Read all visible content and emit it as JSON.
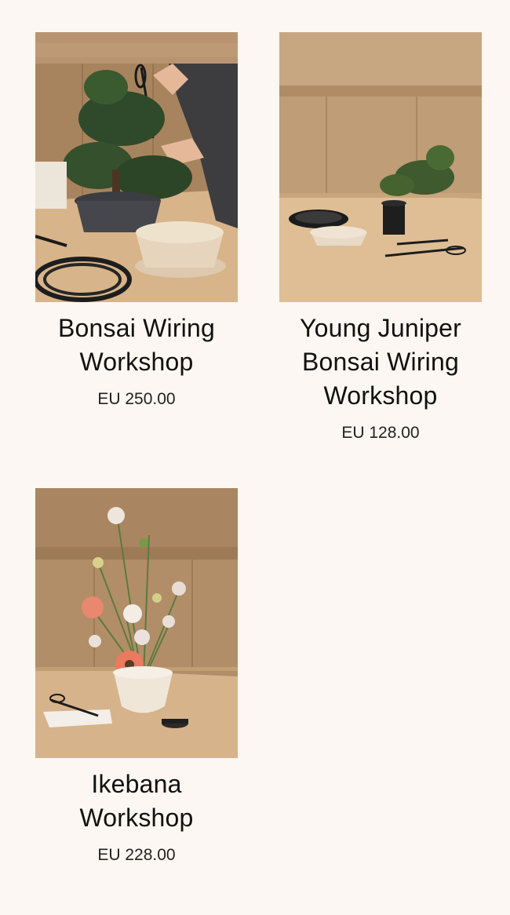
{
  "products": [
    {
      "title": "Bonsai Wiring Workshop",
      "price": "EU 250.00",
      "image": "bonsai-pruning-photo"
    },
    {
      "title": "Young Juniper Bonsai Wiring Workshop",
      "price": "EU 128.00",
      "image": "juniper-bonsai-photo"
    },
    {
      "title": "Ikebana Workshop",
      "price": "EU 228.00",
      "image": "ikebana-photo"
    }
  ],
  "colors": {
    "background": "#fcf7f2",
    "text": "#111111",
    "wood_wall": "#b8946c",
    "table": "#d9b88f"
  }
}
